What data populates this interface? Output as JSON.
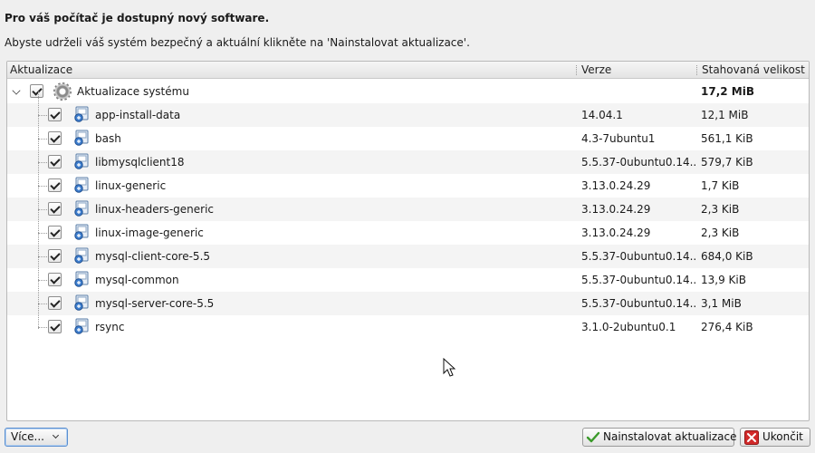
{
  "header": {
    "title": "Pro váš počítač je dostupný nový software.",
    "description": "Abyste udrželi váš systém bezpečný a aktuální klikněte na 'Nainstalovat aktualizace'."
  },
  "table": {
    "columns": [
      "Aktualizace",
      "Verze",
      "Stahovaná velikost"
    ],
    "parent": {
      "name": "Aktualizace systému",
      "size": "17,2 MiB",
      "checked": true,
      "icon": "gear-icon"
    },
    "rows": [
      {
        "name": "app-install-data",
        "version": "14.04.1",
        "size": "12,1 MiB",
        "checked": true
      },
      {
        "name": "bash",
        "version": "4.3-7ubuntu1",
        "size": "561,1 KiB",
        "checked": true
      },
      {
        "name": "libmysqlclient18",
        "version": "5.5.37-0ubuntu0.14....",
        "size": "579,7 KiB",
        "checked": true
      },
      {
        "name": "linux-generic",
        "version": "3.13.0.24.29",
        "size": "1,7 KiB",
        "checked": true
      },
      {
        "name": "linux-headers-generic",
        "version": "3.13.0.24.29",
        "size": "2,3 KiB",
        "checked": true
      },
      {
        "name": "linux-image-generic",
        "version": "3.13.0.24.29",
        "size": "2,3 KiB",
        "checked": true
      },
      {
        "name": "mysql-client-core-5.5",
        "version": "5.5.37-0ubuntu0.14....",
        "size": "684,0 KiB",
        "checked": true
      },
      {
        "name": "mysql-common",
        "version": "5.5.37-0ubuntu0.14....",
        "size": "13,9 KiB",
        "checked": true
      },
      {
        "name": "mysql-server-core-5.5",
        "version": "5.5.37-0ubuntu0.14....",
        "size": "3,1 MiB",
        "checked": true
      },
      {
        "name": "rsync",
        "version": "3.1.0-2ubuntu0.1",
        "size": "276,4 KiB",
        "checked": true
      }
    ]
  },
  "buttons": {
    "more": "Více...",
    "install": "Nainstalovat aktualizace",
    "quit": "Ukončit"
  },
  "icons": {
    "row_icon": "package-icon",
    "install_icon": "checkmark-icon",
    "quit_icon": "close-icon"
  },
  "colors": {
    "accent": "#5a8fd0",
    "quit": "#d22b2b",
    "install_check": "#3a9a2a"
  }
}
